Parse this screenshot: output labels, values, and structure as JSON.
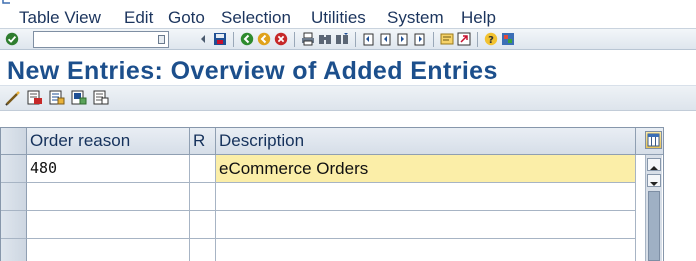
{
  "menu": {
    "items": [
      "Table View",
      "Edit",
      "Goto",
      "Selection",
      "Utilities",
      "System",
      "Help"
    ]
  },
  "toolbar": {
    "command_value": "",
    "icons": [
      "enter-icon",
      "back-icon",
      "exit-icon",
      "cancel-icon",
      "print-icon",
      "find-icon",
      "find-next-icon",
      "first-page-icon",
      "previous-page-icon",
      "next-page-icon",
      "last-page-icon",
      "create-session-icon",
      "shortcut-icon",
      "help-icon",
      "customize-layout-icon"
    ]
  },
  "title": "New Entries: Overview of Added Entries",
  "app_toolbar": {
    "buttons": [
      "change-display-icon",
      "delete-icon",
      "select-all-icon",
      "select-block-icon",
      "deselect-all-icon"
    ]
  },
  "table": {
    "columns": [
      "Order reason",
      "R",
      "Description"
    ],
    "rows": [
      {
        "order_reason": "480",
        "r": "",
        "description": "eCommerce Orders"
      },
      {
        "order_reason": "",
        "r": "",
        "description": ""
      },
      {
        "order_reason": "",
        "r": "",
        "description": ""
      },
      {
        "order_reason": "",
        "r": "",
        "description": ""
      }
    ]
  },
  "colors": {
    "title": "#1c4f8c",
    "highlight_row": "#fbeea8",
    "menu_text": "#1c355e"
  }
}
